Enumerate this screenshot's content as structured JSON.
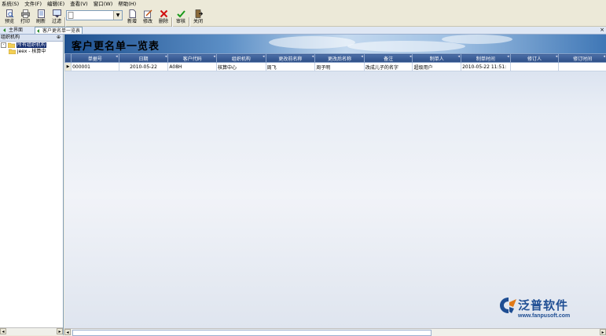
{
  "menu": [
    "系统(S)",
    "文件(F)",
    "编辑(E)",
    "查看(V)",
    "窗口(W)",
    "帮助(H)"
  ],
  "toolbar": {
    "preview": "预览",
    "print": "打印",
    "refresh": "刷新",
    "filter": "过滤",
    "new": "新增",
    "edit": "修改",
    "delete": "删除",
    "approve": "审核",
    "close": "关闭",
    "combo_value": ""
  },
  "tabs": [
    "主界面",
    "客户更名单一览表"
  ],
  "left_panel": {
    "title": "组织机构",
    "root": "所有组织机构",
    "child": "jeex - 核算中"
  },
  "page_title": "客户更名单一览表",
  "table": {
    "columns": [
      "单据号",
      "日期",
      "客户代码",
      "组织机构",
      "更改前名称",
      "更改后名称",
      "备注",
      "制单人",
      "制单时间",
      "修订人",
      "修订时间"
    ],
    "rows": [
      [
        "000001",
        "2010-05-22",
        "A08H",
        "核算中心",
        "周飞",
        "周子明",
        "改成儿子的名字",
        "超级用户",
        "2010-05-22 11:51:",
        "",
        ""
      ]
    ]
  },
  "watermark": {
    "name": "泛普软件",
    "url": "www.fanpusoft.com"
  },
  "colors": {
    "header_bg": "#2d4e86",
    "brand": "#1f4e93",
    "selection": "#0a246a"
  }
}
